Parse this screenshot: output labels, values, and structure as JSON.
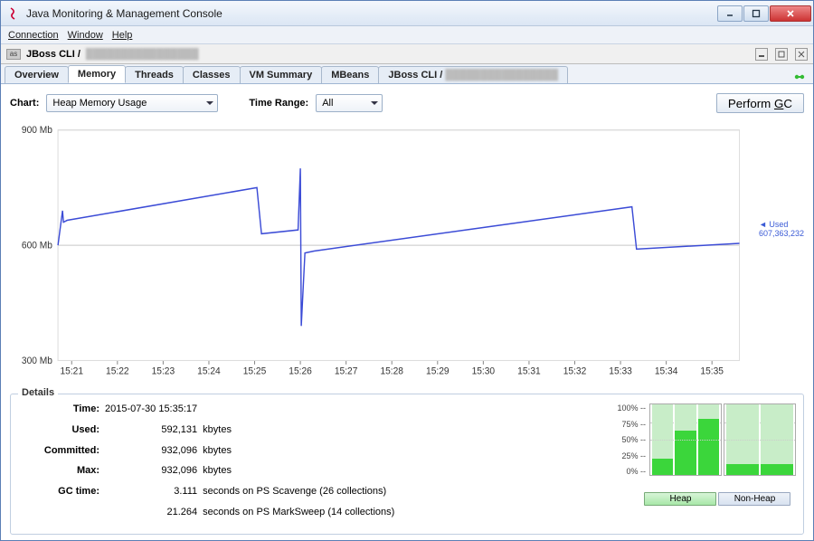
{
  "window": {
    "title": "Java Monitoring & Management Console"
  },
  "menubar": {
    "conn": "Connection",
    "win": "Window",
    "help": "Help"
  },
  "intframe": {
    "prefix": "JBoss CLI /",
    "blurred": "████████████████"
  },
  "tabs": {
    "overview": "Overview",
    "memory": "Memory",
    "threads": "Threads",
    "classes": "Classes",
    "vmsummary": "VM Summary",
    "mbeans": "MBeans",
    "jbosscli": "JBoss CLI /",
    "jbosscli_blur": "████████████████"
  },
  "toolbar": {
    "chart_label": "Chart:",
    "chart_value": "Heap Memory Usage",
    "range_label": "Time Range:",
    "range_value": "All",
    "gc_button_pre": "Perform ",
    "gc_button_u": "G",
    "gc_button_post": "C"
  },
  "chart_data": {
    "type": "line",
    "title": "",
    "ylabel": "",
    "xlabel": "",
    "ylim": [
      300,
      900
    ],
    "yticks": [
      300,
      600,
      900
    ],
    "ytick_labels": [
      "300 Mb",
      "600 Mb",
      "900 Mb"
    ],
    "xticks": [
      "15:21",
      "15:22",
      "15:23",
      "15:24",
      "15:25",
      "15:26",
      "15:27",
      "15:28",
      "15:29",
      "15:30",
      "15:31",
      "15:32",
      "15:33",
      "15:34",
      "15:35"
    ],
    "series": [
      {
        "name": "Used",
        "x": [
          0,
          0.1,
          0.12,
          0.2,
          4.35,
          4.45,
          5.25,
          5.3,
          5.32,
          5.4,
          5.6,
          12.55,
          12.65,
          14.9
        ],
        "y": [
          600,
          690,
          660,
          665,
          750,
          630,
          640,
          800,
          390,
          580,
          585,
          700,
          590,
          605
        ]
      }
    ],
    "current_label": "Used",
    "current_value": "607,363,232"
  },
  "details": {
    "title": "Details",
    "rows": [
      {
        "k": "Time:",
        "v": "2015-07-30 15:35:17",
        "t": ""
      },
      {
        "k": "Used:",
        "v": "592,131",
        "t": "kbytes"
      },
      {
        "k": "Committed:",
        "v": "932,096",
        "t": "kbytes"
      },
      {
        "k": "Max:",
        "v": "932,096",
        "t": "kbytes"
      },
      {
        "k": "GC time:",
        "v": "3.111",
        "t": "seconds on PS Scavenge (26 collections)"
      },
      {
        "k": "",
        "v": "21.264",
        "t": "seconds on PS MarkSweep (14 collections)"
      }
    ]
  },
  "minibars": {
    "yticks": [
      "100% --",
      "75% --",
      "50% --",
      "25% --",
      "0% --"
    ],
    "heap_label": "Heap",
    "nonheap_label": "Non-Heap",
    "heap_fills": [
      23,
      63,
      80
    ],
    "nonheap_fills": [
      15,
      15
    ]
  }
}
